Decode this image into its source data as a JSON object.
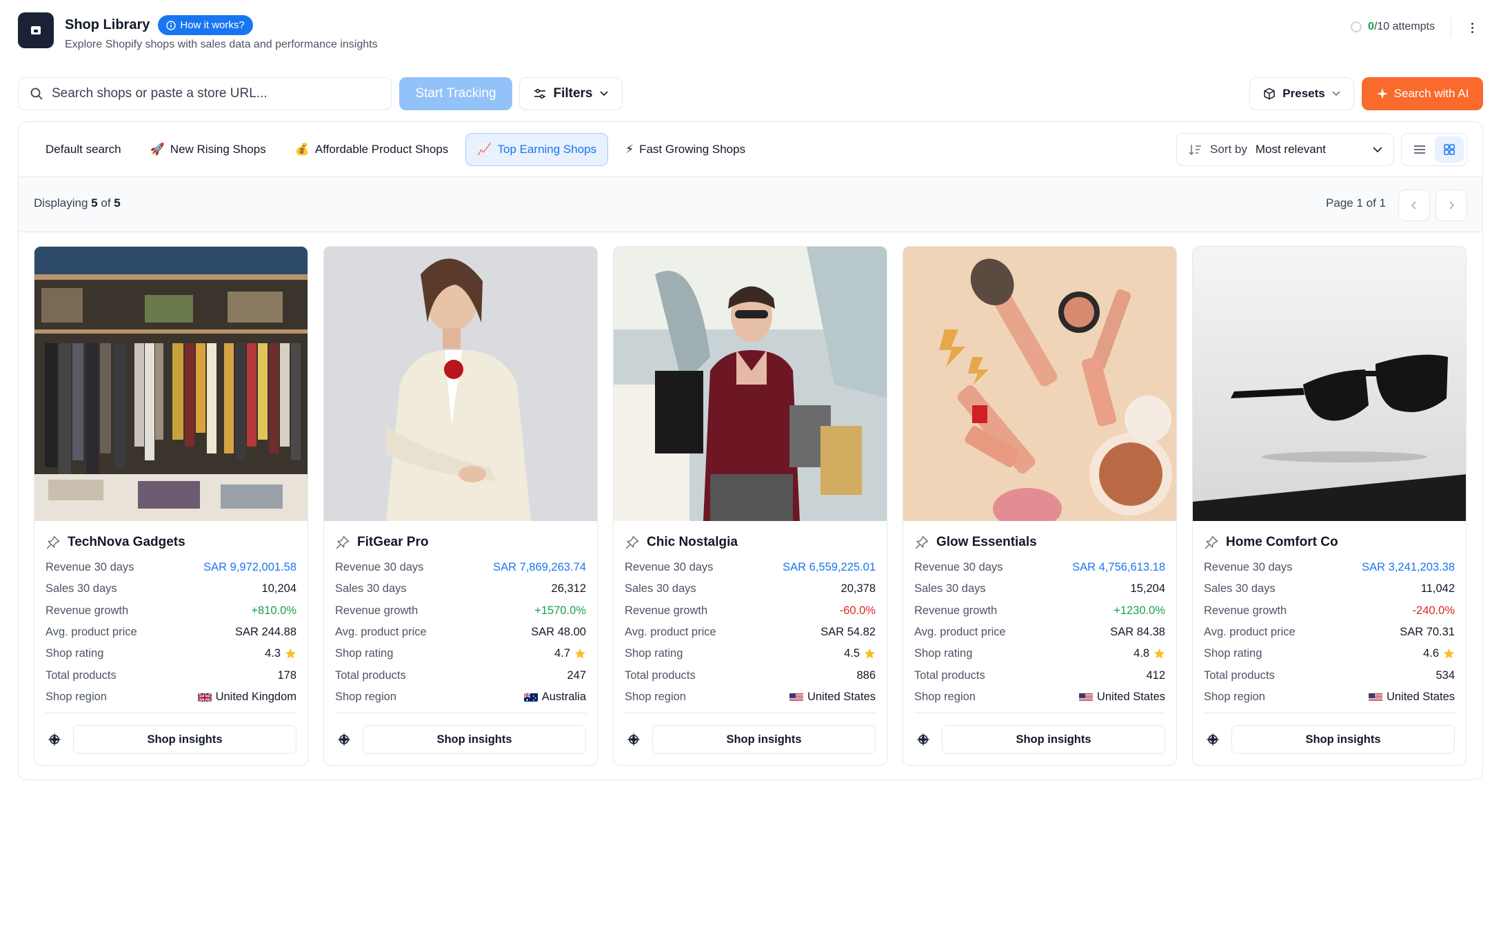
{
  "header": {
    "title": "Shop Library",
    "how_it_works": "How it works?",
    "subtitle": "Explore Shopify shops with sales data and performance insights",
    "attempts_used": "0",
    "attempts_total": "/10 attempts"
  },
  "toolbar": {
    "search_placeholder": "Search shops or paste a store URL...",
    "start_tracking": "Start Tracking",
    "filters": "Filters",
    "presets": "Presets",
    "search_ai": "Search with AI"
  },
  "tabs": [
    {
      "label": "Default search",
      "icon": ""
    },
    {
      "label": "New Rising Shops",
      "icon": "🚀"
    },
    {
      "label": "Affordable Product Shops",
      "icon": "💰"
    },
    {
      "label": "Top Earning Shops",
      "icon": "📈",
      "active": true
    },
    {
      "label": "Fast Growing Shops",
      "icon": "⚡"
    }
  ],
  "sort": {
    "label": "Sort by",
    "value": "Most relevant"
  },
  "results": {
    "prefix": "Displaying",
    "shown": "5",
    "of": "of",
    "total": "5",
    "page": "Page 1 of 1"
  },
  "row_labels": {
    "revenue": "Revenue 30 days",
    "sales": "Sales 30 days",
    "growth": "Revenue growth",
    "avg_price": "Avg. product price",
    "rating": "Shop rating",
    "products": "Total products",
    "region": "Shop region"
  },
  "insights_label": "Shop insights",
  "colors": {
    "accent": "#1976f2",
    "ai": "#f96a2c",
    "positive": "#16a34a",
    "negative": "#dc2626",
    "star": "#fbbf24"
  },
  "shops": [
    {
      "name": "TechNova Gadgets",
      "revenue": "SAR 9,972,001.58",
      "sales": "10,204",
      "growth": "+810.0%",
      "growth_dir": "up",
      "avg_price": "SAR 244.88",
      "rating": "4.3",
      "products": "178",
      "region": "United Kingdom",
      "flag": "gb"
    },
    {
      "name": "FitGear Pro",
      "revenue": "SAR 7,869,263.74",
      "sales": "26,312",
      "growth": "+1570.0%",
      "growth_dir": "up",
      "avg_price": "SAR 48.00",
      "rating": "4.7",
      "products": "247",
      "region": "Australia",
      "flag": "au"
    },
    {
      "name": "Chic Nostalgia",
      "revenue": "SAR 6,559,225.01",
      "sales": "20,378",
      "growth": "-60.0%",
      "growth_dir": "down",
      "avg_price": "SAR 54.82",
      "rating": "4.5",
      "products": "886",
      "region": "United States",
      "flag": "us"
    },
    {
      "name": "Glow Essentials",
      "revenue": "SAR 4,756,613.18",
      "sales": "15,204",
      "growth": "+1230.0%",
      "growth_dir": "up",
      "avg_price": "SAR 84.38",
      "rating": "4.8",
      "products": "412",
      "region": "United States",
      "flag": "us"
    },
    {
      "name": "Home Comfort Co",
      "revenue": "SAR 3,241,203.38",
      "sales": "11,042",
      "growth": "-240.0%",
      "growth_dir": "down",
      "avg_price": "SAR 70.31",
      "rating": "4.6",
      "products": "534",
      "region": "United States",
      "flag": "us"
    }
  ]
}
